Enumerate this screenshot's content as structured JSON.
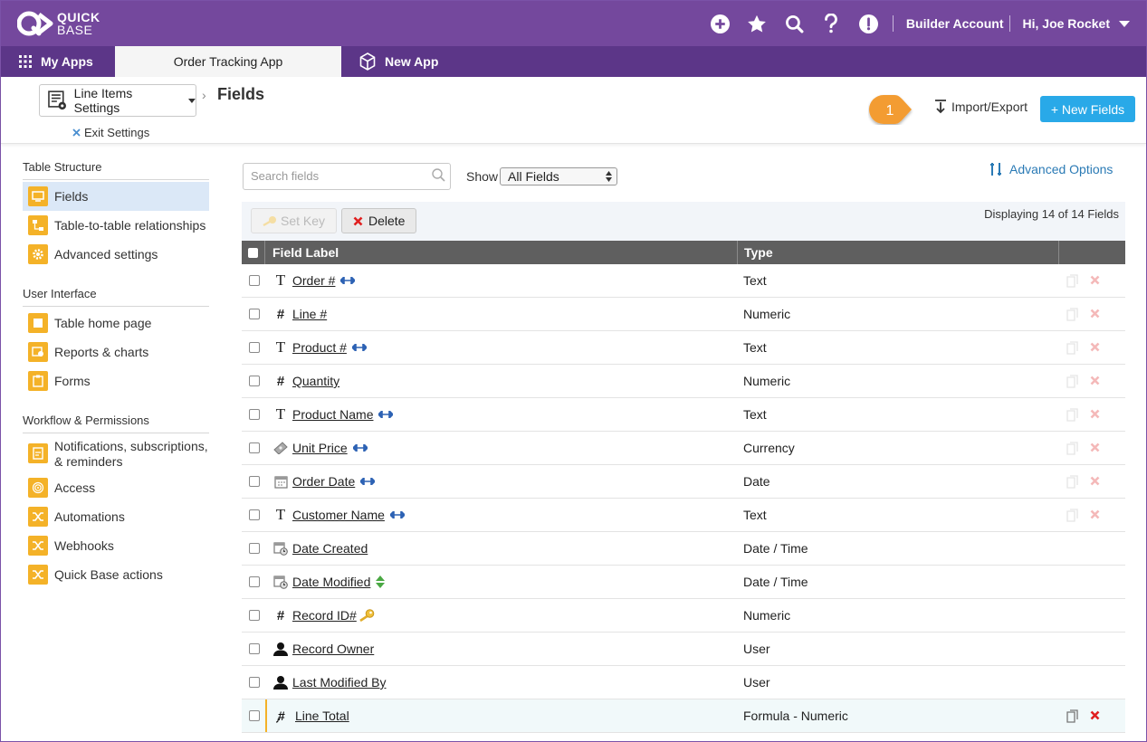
{
  "brand": {
    "line1": "QUICK",
    "line2": "BASE"
  },
  "header": {
    "builder_account": "Builder Account",
    "user": "Hi, Joe Rocket"
  },
  "tabs": {
    "my_apps": "My Apps",
    "active": "Order Tracking App",
    "new_app": "New App"
  },
  "settings": {
    "dropdown": "Line Items Settings",
    "page_title": "Fields",
    "exit": "Exit Settings",
    "badge": "1",
    "import_export": "Import/Export",
    "new_fields": "+ New Fields"
  },
  "sidebar": {
    "table_structure": "Table Structure",
    "fields": "Fields",
    "relationships": "Table-to-table relationships",
    "advanced_settings": "Advanced settings",
    "user_interface": "User Interface",
    "table_home": "Table home page",
    "reports": "Reports & charts",
    "forms": "Forms",
    "workflow": "Workflow & Permissions",
    "notifications_1": "Notifications, subscriptions,",
    "notifications_2": "& reminders",
    "access": "Access",
    "automations": "Automations",
    "webhooks": "Webhooks",
    "actions": "Quick Base actions"
  },
  "filters": {
    "search_placeholder": "Search fields",
    "show_label": "Show",
    "show_value": "All Fields",
    "advanced": "Advanced Options"
  },
  "toolbar": {
    "set_key": "Set Key",
    "delete": "Delete",
    "displaying": "Displaying 14 of 14 Fields"
  },
  "table": {
    "col_label": "Field Label",
    "col_type": "Type",
    "rows": [
      {
        "label": "Order #",
        "type": "Text"
      },
      {
        "label": "Line #",
        "type": "Numeric"
      },
      {
        "label": "Product #",
        "type": "Text"
      },
      {
        "label": "Quantity",
        "type": "Numeric"
      },
      {
        "label": "Product Name",
        "type": "Text"
      },
      {
        "label": "Unit Price",
        "type": "Currency"
      },
      {
        "label": "Order Date",
        "type": "Date"
      },
      {
        "label": "Customer Name",
        "type": "Text"
      },
      {
        "label": "Date Created",
        "type": "Date / Time"
      },
      {
        "label": "Date Modified",
        "type": "Date / Time"
      },
      {
        "label": "Record ID#",
        "type": "Numeric"
      },
      {
        "label": "Record Owner",
        "type": "User"
      },
      {
        "label": "Last Modified By",
        "type": "User"
      },
      {
        "label": "Line Total",
        "type": "Formula - Numeric"
      }
    ]
  },
  "colors": {
    "brand_purple": "#74489d",
    "tab_purple": "#5c3688",
    "accent_blue": "#29a9e8",
    "badge_orange": "#f39c33",
    "icon_yellow": "#f4b228"
  }
}
